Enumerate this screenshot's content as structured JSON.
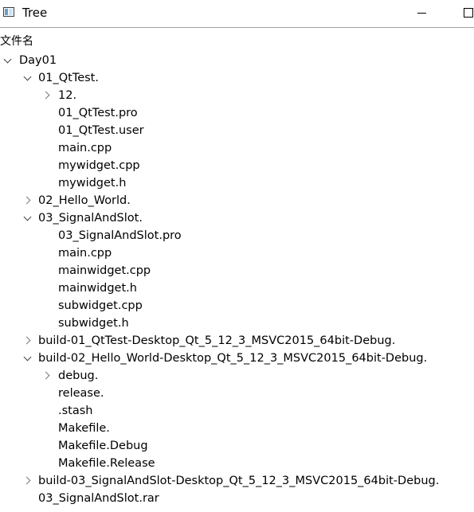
{
  "window": {
    "title": "Tree",
    "icon": "qt-window-icon"
  },
  "header": {
    "column_label": "文件名"
  },
  "tree": [
    {
      "label": "Day01",
      "depth": 0,
      "state": "expanded"
    },
    {
      "label": "01_QtTest.",
      "depth": 1,
      "state": "expanded"
    },
    {
      "label": "12.",
      "depth": 2,
      "state": "collapsed"
    },
    {
      "label": "01_QtTest.pro",
      "depth": 2,
      "state": "leaf"
    },
    {
      "label": "01_QtTest.user",
      "depth": 2,
      "state": "leaf"
    },
    {
      "label": "main.cpp",
      "depth": 2,
      "state": "leaf"
    },
    {
      "label": "mywidget.cpp",
      "depth": 2,
      "state": "leaf"
    },
    {
      "label": "mywidget.h",
      "depth": 2,
      "state": "leaf"
    },
    {
      "label": "02_Hello_World.",
      "depth": 1,
      "state": "collapsed"
    },
    {
      "label": "03_SignalAndSlot.",
      "depth": 1,
      "state": "expanded"
    },
    {
      "label": "03_SignalAndSlot.pro",
      "depth": 2,
      "state": "leaf"
    },
    {
      "label": "main.cpp",
      "depth": 2,
      "state": "leaf"
    },
    {
      "label": "mainwidget.cpp",
      "depth": 2,
      "state": "leaf"
    },
    {
      "label": "mainwidget.h",
      "depth": 2,
      "state": "leaf"
    },
    {
      "label": "subwidget.cpp",
      "depth": 2,
      "state": "leaf"
    },
    {
      "label": "subwidget.h",
      "depth": 2,
      "state": "leaf"
    },
    {
      "label": "build-01_QtTest-Desktop_Qt_5_12_3_MSVC2015_64bit-Debug.",
      "depth": 1,
      "state": "collapsed"
    },
    {
      "label": "build-02_Hello_World-Desktop_Qt_5_12_3_MSVC2015_64bit-Debug.",
      "depth": 1,
      "state": "expanded"
    },
    {
      "label": "debug.",
      "depth": 2,
      "state": "collapsed"
    },
    {
      "label": "release.",
      "depth": 2,
      "state": "leaf"
    },
    {
      "label": ".stash",
      "depth": 2,
      "state": "leaf"
    },
    {
      "label": "Makefile.",
      "depth": 2,
      "state": "leaf"
    },
    {
      "label": "Makefile.Debug",
      "depth": 2,
      "state": "leaf"
    },
    {
      "label": "Makefile.Release",
      "depth": 2,
      "state": "leaf"
    },
    {
      "label": "build-03_SignalAndSlot-Desktop_Qt_5_12_3_MSVC2015_64bit-Debug.",
      "depth": 1,
      "state": "collapsed"
    },
    {
      "label": "03_SignalAndSlot.rar",
      "depth": 1,
      "state": "leaf"
    }
  ]
}
